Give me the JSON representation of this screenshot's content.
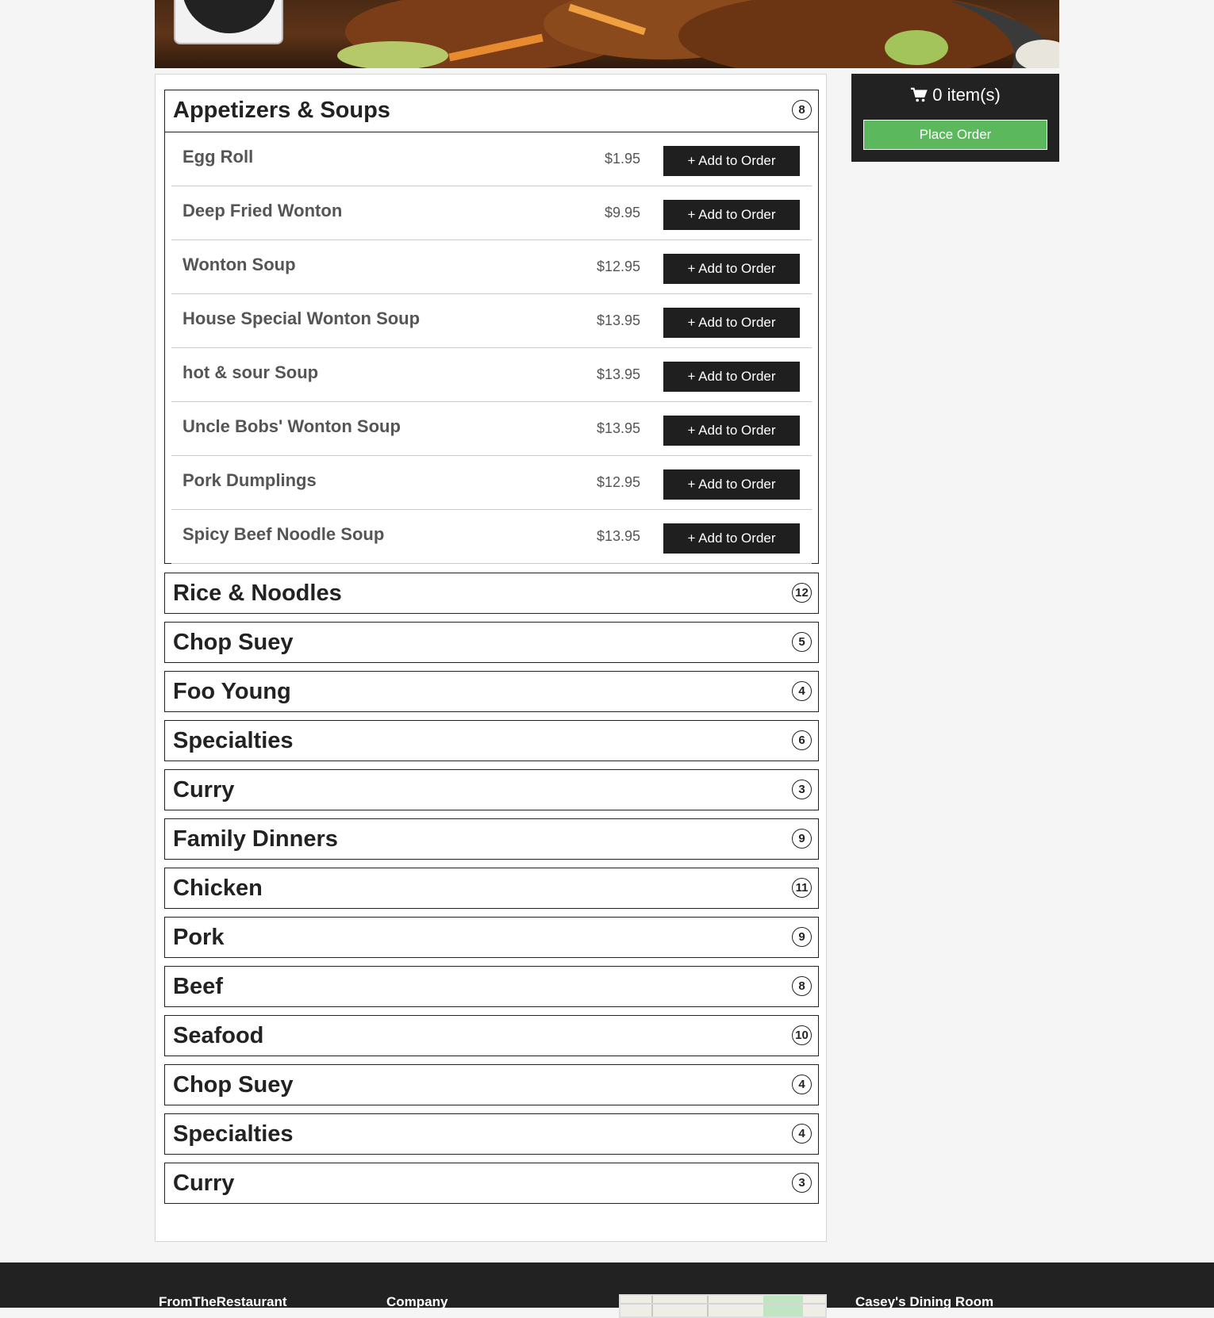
{
  "cart": {
    "count_label": "0 item(s)",
    "place_order_label": "Place Order"
  },
  "add_label": "+ Add to Order",
  "sections": [
    {
      "title": "Appetizers & Soups",
      "count": "8",
      "expanded": true,
      "items": [
        {
          "name": "Egg Roll",
          "price": "$1.95"
        },
        {
          "name": "Deep Fried Wonton",
          "price": "$9.95"
        },
        {
          "name": "Wonton Soup",
          "price": "$12.95"
        },
        {
          "name": "House Special Wonton Soup",
          "price": "$13.95"
        },
        {
          "name": "hot & sour Soup",
          "price": "$13.95"
        },
        {
          "name": "Uncle Bobs' Wonton Soup",
          "price": "$13.95"
        },
        {
          "name": "Pork Dumplings",
          "price": "$12.95"
        },
        {
          "name": "Spicy Beef Noodle Soup",
          "price": "$13.95"
        }
      ]
    },
    {
      "title": "Rice & Noodles",
      "count": "12"
    },
    {
      "title": "Chop Suey",
      "count": "5"
    },
    {
      "title": "Foo Young",
      "count": "4"
    },
    {
      "title": "Specialties",
      "count": "6"
    },
    {
      "title": "Curry",
      "count": "3"
    },
    {
      "title": "Family Dinners",
      "count": "9"
    },
    {
      "title": "Chicken",
      "count": "11"
    },
    {
      "title": "Pork",
      "count": "9"
    },
    {
      "title": "Beef",
      "count": "8"
    },
    {
      "title": "Seafood",
      "count": "10"
    },
    {
      "title": "Chop Suey",
      "count": "4"
    },
    {
      "title": "Specialties",
      "count": "4"
    },
    {
      "title": "Curry",
      "count": "3"
    }
  ],
  "footer": {
    "col1": "FromTheRestaurant",
    "col2": "Company",
    "col3": "Casey's Dining Room"
  }
}
